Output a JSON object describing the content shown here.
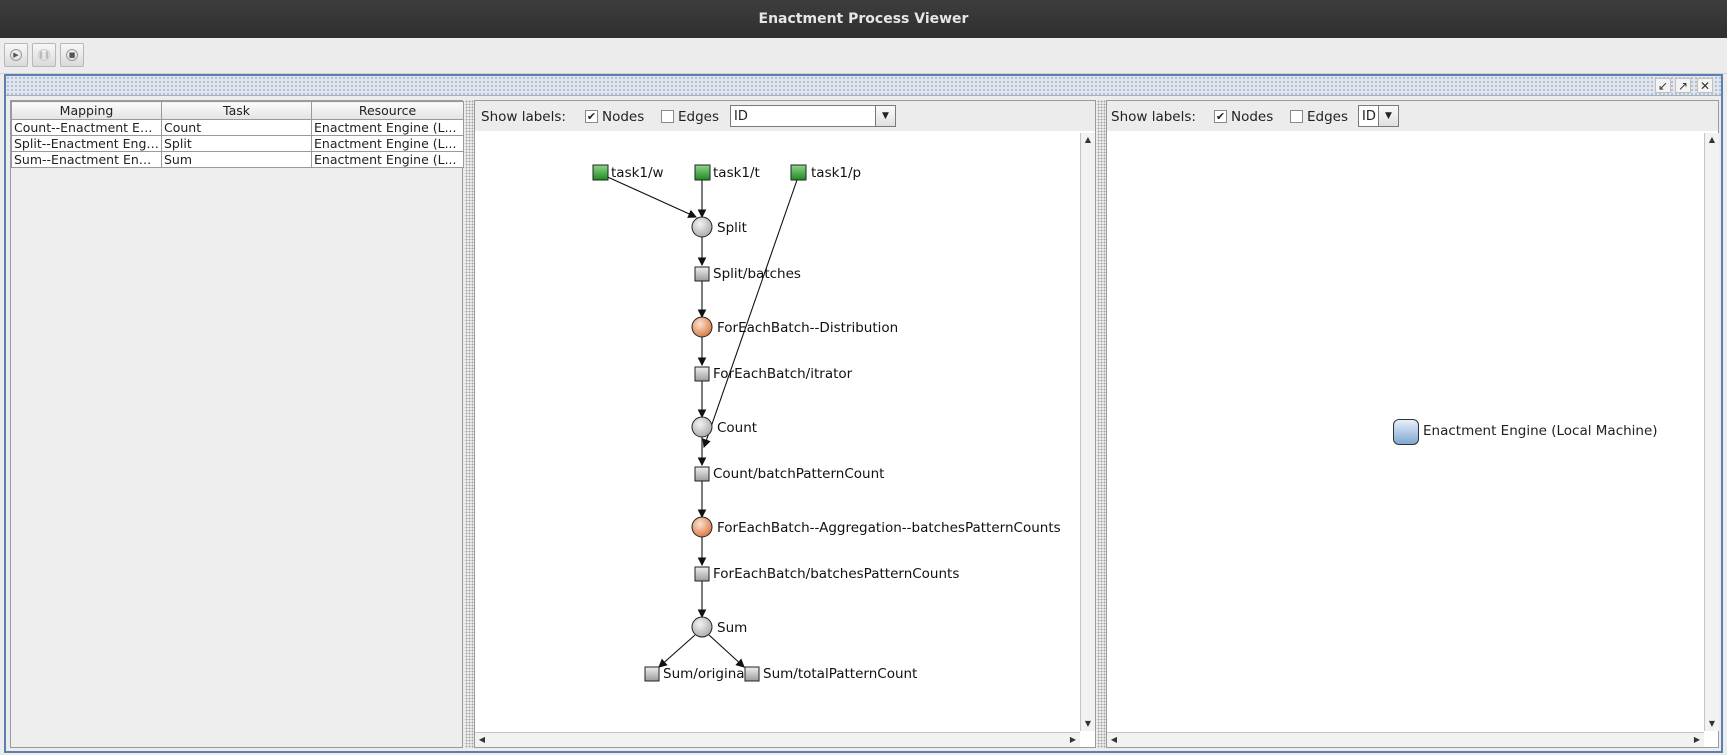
{
  "window": {
    "title": "Enactment Process Viewer"
  },
  "toolbar": {
    "play_icon": "play-icon",
    "pause_icon": "pause-icon",
    "stop_icon": "stop-icon"
  },
  "table": {
    "headers": [
      "Mapping",
      "Task",
      "Resource"
    ],
    "rows": [
      [
        "Count--Enactment En...",
        "Count",
        "Enactment Engine (L..."
      ],
      [
        "Split--Enactment Engi...",
        "Split",
        "Enactment Engine (L..."
      ],
      [
        "Sum--Enactment Engi...",
        "Sum",
        "Enactment Engine (L..."
      ]
    ]
  },
  "process_panel": {
    "show_labels": "Show labels:",
    "nodes_label": "Nodes",
    "nodes_checked": true,
    "edges_label": "Edges",
    "edges_checked": false,
    "label_mode": "ID",
    "graph_labels": {
      "task1_w": "task1/w",
      "task1_t": "task1/t",
      "task1_p": "task1/p",
      "split": "Split",
      "split_batches": "Split/batches",
      "dist": "ForEachBatch--Distribution",
      "itrator": "ForEachBatch/itrator",
      "count": "Count",
      "count_bpc": "Count/batchPatternCount",
      "agg": "ForEachBatch--Aggregation--batchesPatternCounts",
      "batches_pc": "ForEachBatch/batchesPatternCounts",
      "sum": "Sum",
      "sum_orig": "Sum/originalS",
      "sum_total": "Sum/totalPatternCount"
    }
  },
  "resource_panel": {
    "show_labels": "Show labels:",
    "nodes_label": "Nodes",
    "nodes_checked": true,
    "edges_label": "Edges",
    "edges_checked": false,
    "label_mode": "ID",
    "resource_label": "Enactment Engine (Local Machine)"
  },
  "colors": {
    "source_node": "#33a033",
    "data_node": "#bdbdbd",
    "task_node": "#cfcfcf",
    "control_node": "#e8915a",
    "resource_node": "#a9c8e8",
    "frame_border": "#5a7fb0"
  }
}
